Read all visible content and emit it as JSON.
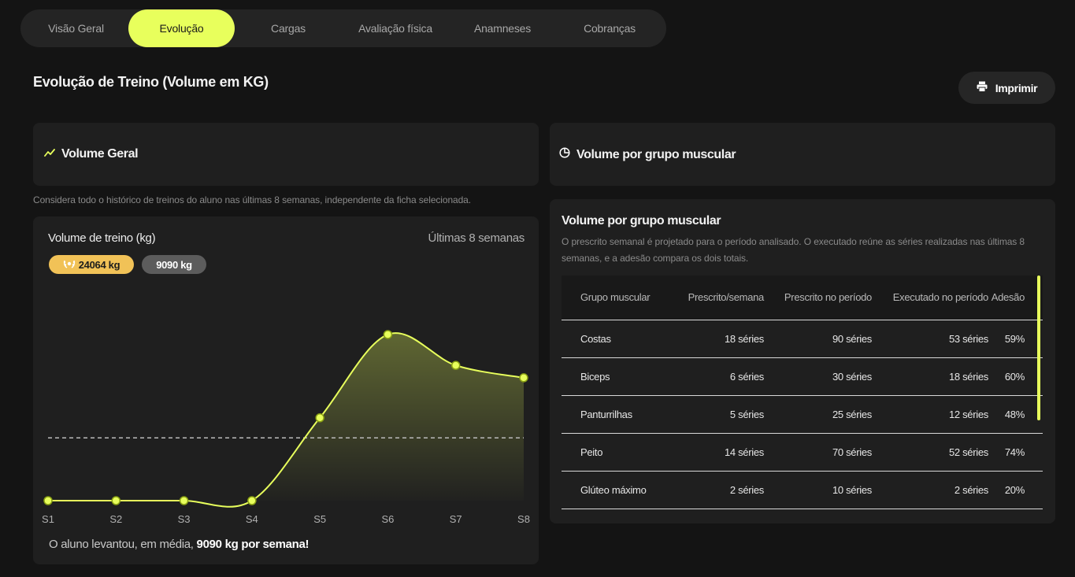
{
  "tabs": [
    {
      "label": "Visão Geral",
      "active": false
    },
    {
      "label": "Evolução",
      "active": true
    },
    {
      "label": "Cargas",
      "active": false
    },
    {
      "label": "Avaliação física",
      "active": false
    },
    {
      "label": "Anamneses",
      "active": false
    },
    {
      "label": "Cobranças",
      "active": false
    }
  ],
  "page": {
    "title": "Evolução de Treino (Volume em KG)",
    "print_label": "Imprimir"
  },
  "volume_geral": {
    "header": "Volume Geral",
    "hint": "Considera todo o histórico de treinos do aluno nas últimas 8 semanas, independente da ficha selecionada.",
    "chart_title": "Volume de treino (kg)",
    "period": "Últimas 8 semanas",
    "badge_max": "24064 kg",
    "badge_avg": "9090 kg",
    "avg_prefix": "O aluno levantou,  em média, ",
    "avg_value": "9090 kg por semana!"
  },
  "chart_data": {
    "type": "area",
    "categories": [
      "S1",
      "S2",
      "S3",
      "S4",
      "S5",
      "S6",
      "S7",
      "S8"
    ],
    "values": [
      0,
      0,
      0,
      0,
      12000,
      24064,
      19600,
      17800
    ],
    "average": 9090,
    "ylim": [
      0,
      26000
    ],
    "grid": false,
    "colors": {
      "line": "#e8ff5c",
      "average_line": "#bbbbbb"
    }
  },
  "grupo_muscular": {
    "header": "Volume por grupo muscular",
    "title": "Volume por grupo muscular",
    "description": "O prescrito semanal é projetado para o período analisado. O executado reúne as séries realizadas nas últimas 8 semanas, e a adesão compara os dois totais.",
    "columns": [
      "Grupo muscular",
      "Prescrito/semana",
      "Prescrito no período",
      "Executado no período",
      "Adesão"
    ],
    "rows": [
      [
        "Costas",
        "18 séries",
        "90 séries",
        "53 séries",
        "59%"
      ],
      [
        "Biceps",
        "6 séries",
        "30 séries",
        "18 séries",
        "60%"
      ],
      [
        "Panturrilhas",
        "5 séries",
        "25 séries",
        "12 séries",
        "48%"
      ],
      [
        "Peito",
        "14 séries",
        "70 séries",
        "52 séries",
        "74%"
      ],
      [
        "Glúteo máximo",
        "2 séries",
        "10 séries",
        "2 séries",
        "20%"
      ]
    ]
  },
  "colors": {
    "accent": "#e8ff5c",
    "gold": "#f1c257",
    "background": "#141414",
    "card": "#1f1f1f"
  }
}
